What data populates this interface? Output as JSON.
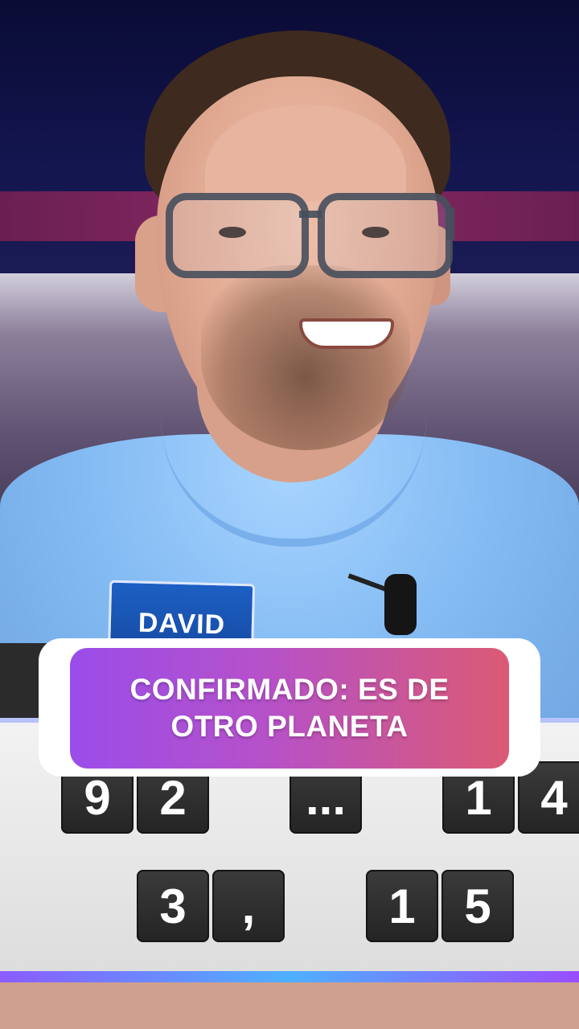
{
  "caption": {
    "line1": "CONFIRMADO: ES DE",
    "line2": "OTRO PLANETA"
  },
  "name_tag": "DAVID",
  "board": {
    "row1": [
      "9",
      "2",
      "...",
      "1",
      "4"
    ],
    "row2": [
      "3",
      ",",
      "1",
      "5"
    ]
  },
  "colors": {
    "caption_gradient_start": "#9a4dea",
    "caption_gradient_end": "#db5a74",
    "shirt": "#86bdf4",
    "name_tag": "#1d5fc3",
    "tile": "#2d2d2d"
  }
}
